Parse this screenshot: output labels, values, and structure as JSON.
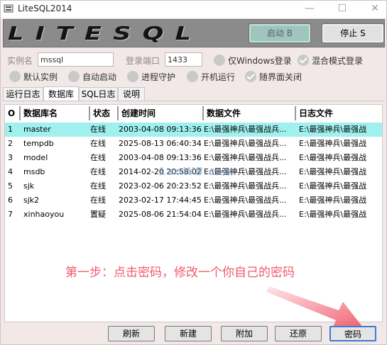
{
  "window": {
    "title": "LiteSQL2014"
  },
  "banner": {
    "logo": "LITESQL",
    "start_label": "启动 B",
    "stop_label": "停止 S"
  },
  "form": {
    "instance_label": "实例名",
    "instance_value": "mssql",
    "port_label": "登录端口",
    "port_value": "1433",
    "options": [
      {
        "label": "仅Windows登录",
        "checked": false,
        "dim": false
      },
      {
        "label": "混合模式登录",
        "checked": true,
        "dim": false
      },
      {
        "label": "默认实例",
        "checked": false,
        "dim": false
      },
      {
        "label": "自动启动",
        "checked": false,
        "dim": false
      },
      {
        "label": "进程守护",
        "checked": false,
        "dim": false
      },
      {
        "label": "开机运行",
        "checked": false,
        "dim": false
      },
      {
        "label": "随界面关闭",
        "checked": true,
        "dim": false
      }
    ]
  },
  "tabs": [
    {
      "label": "运行日志",
      "active": false
    },
    {
      "label": "数据库",
      "active": true
    },
    {
      "label": "SQL日志",
      "active": false
    },
    {
      "label": "说明",
      "active": false
    }
  ],
  "grid": {
    "headers": [
      "O",
      "数据库名",
      "状态",
      "创建时间",
      "数据文件",
      "日志文件"
    ],
    "rows": [
      [
        "1",
        "master",
        "在线",
        "2003-04-08 09:13:36",
        "E:\\最强神兵\\最强战兵...",
        "E:\\最强神兵\\最强战"
      ],
      [
        "2",
        "tempdb",
        "在线",
        "2025-08-13 06:40:34",
        "E:\\最强神兵\\最强战兵...",
        "E:\\最强神兵\\最强战"
      ],
      [
        "3",
        "model",
        "在线",
        "2003-04-08 09:13:36",
        "E:\\最强神兵\\最强战兵...",
        "E:\\最强神兵\\最强战"
      ],
      [
        "4",
        "msdb",
        "在线",
        "2014-02-20 20:58:02",
        "E:\\最强神兵\\最强战兵...",
        "E:\\最强神兵\\最强战"
      ],
      [
        "5",
        "sjk",
        "在线",
        "2023-02-06 20:23:52",
        "E:\\最强神兵\\最强战兵...",
        "E:\\最强神兵\\最强战"
      ],
      [
        "6",
        "sjk2",
        "在线",
        "2023-02-17 17:44:45",
        "E:\\最强神兵\\最强战兵...",
        "E:\\最强神兵\\最强战"
      ],
      [
        "7",
        "xinhaoyou",
        "置疑",
        "2025-08-06 21:54:04",
        "E:\\最强神兵\\最强战兵...",
        "E:\\最强神兵\\最强战"
      ]
    ],
    "selected_row": 0
  },
  "watermark": "LaoWB.com",
  "annotation": "第一步：点击密码，修改一个你自己的密码",
  "buttons": [
    {
      "label": "刷新",
      "focus": false
    },
    {
      "label": "新建",
      "focus": false
    },
    {
      "label": "附加",
      "focus": false
    },
    {
      "label": "还原",
      "focus": false
    },
    {
      "label": "密码",
      "focus": true
    }
  ],
  "colors": {
    "annotation": "#f15a6a",
    "selected_row": "#9ff0ee",
    "banner": "#8b8b8b"
  }
}
